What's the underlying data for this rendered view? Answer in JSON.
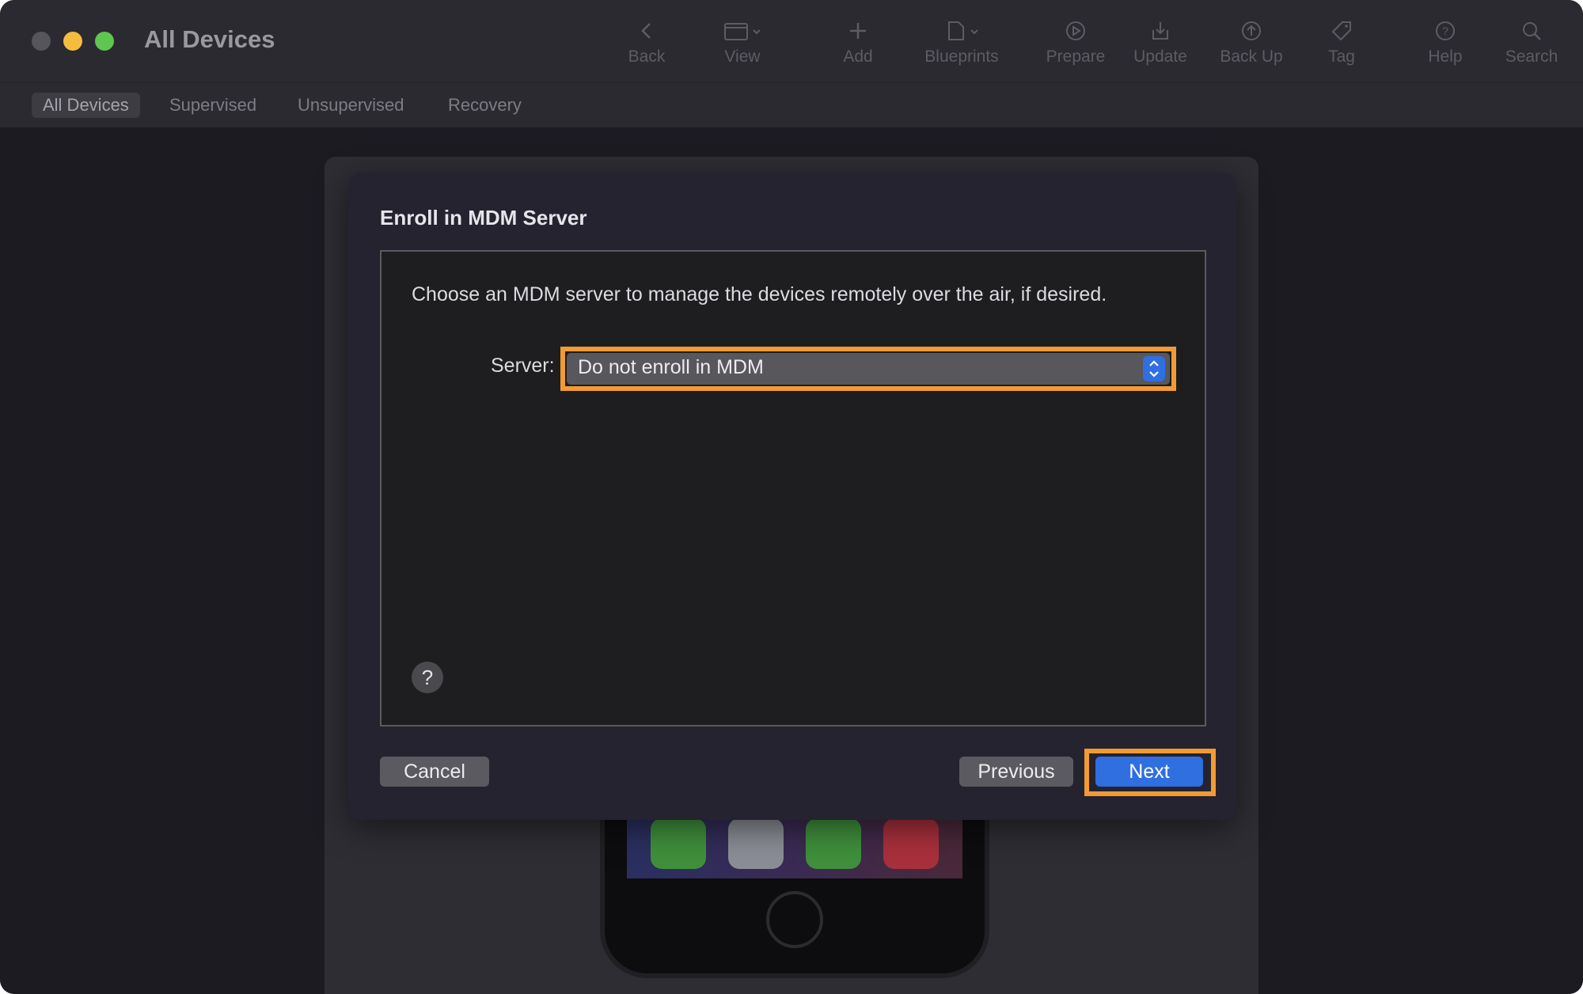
{
  "window": {
    "title": "All Devices"
  },
  "toolbar": {
    "items": [
      {
        "label": "Back",
        "icon": "chevron-left-icon"
      },
      {
        "label": "View",
        "icon": "window-view-icon"
      },
      {
        "label": "Add",
        "icon": "plus-icon"
      },
      {
        "label": "Blueprints",
        "icon": "blueprints-icon"
      },
      {
        "label": "Prepare",
        "icon": "prepare-icon"
      },
      {
        "label": "Update",
        "icon": "update-icon"
      },
      {
        "label": "Back Up",
        "icon": "backup-icon"
      },
      {
        "label": "Tag",
        "icon": "tag-icon"
      },
      {
        "label": "Help",
        "icon": "help-icon"
      },
      {
        "label": "Search",
        "icon": "search-icon"
      }
    ]
  },
  "filters": {
    "items": [
      "All Devices",
      "Supervised",
      "Unsupervised",
      "Recovery"
    ],
    "selected": "All Devices"
  },
  "dialog": {
    "title": "Enroll in MDM Server",
    "description": "Choose an MDM server to manage the devices remotely over the air, if desired.",
    "server_label": "Server:",
    "server_value": "Do not enroll in MDM",
    "help_label": "?",
    "cancel_label": "Cancel",
    "previous_label": "Previous",
    "next_label": "Next"
  },
  "colors": {
    "highlight": "#f29a33",
    "accent": "#2f6fe0"
  }
}
